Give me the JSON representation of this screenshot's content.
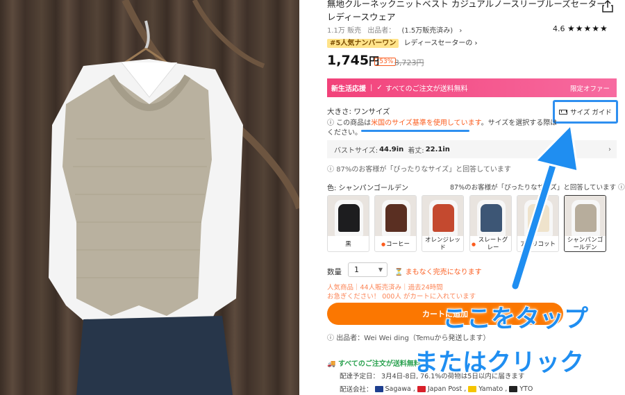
{
  "product": {
    "title": "無地クルーネックニットベスト カジュアルノースリーブルーズセーター レディースウェア",
    "sold": "1.1万 販売",
    "seller_label": "出品者：",
    "seller_sales": "(1.5万販売済み)",
    "rating": "4.6",
    "stars": "★★★★★",
    "rank_tag": "#5人気ナンバーワン",
    "rank_category": "レディースセーターの",
    "price": "1,745",
    "price_unit": "円",
    "discount": "-53%",
    "original_price": "3,723円"
  },
  "promo": {
    "label": "新生活応援",
    "text": "すべてのご注文が送料無料",
    "limited": "限定オファー"
  },
  "size": {
    "label": "大きさ: ワンサイズ",
    "guide_button": "サイズ ガイド",
    "note_prefix": "この商品は",
    "note_highlight": "米国のサイズ基準を使用しています",
    "note_suffix": "。サイズを選択する際はください。",
    "measure_bust_label": "バストサイズ:",
    "measure_bust": "44.9in",
    "measure_length_label": "着丈:",
    "measure_length": "22.1in",
    "fit_note": "87%のお客様が「ぴったりなサイズ」と回答しています"
  },
  "color": {
    "label": "色: シャンパンゴールデン",
    "fit_note": "87%のお客様が「ぴったりなサイズ」と回答しています",
    "swatches": [
      {
        "name": "黒",
        "color": "#1d1d1f",
        "hot": false
      },
      {
        "name": "コーヒー",
        "color": "#5a2f22",
        "hot": true
      },
      {
        "name": "オレンジレッド",
        "color": "#c4492f",
        "hot": false
      },
      {
        "name": "スレートグレー",
        "color": "#3d5675",
        "hot": true
      },
      {
        "name": "アプリコット",
        "color": "#efe3cc",
        "hot": false
      },
      {
        "name": "シャンパンゴールデン",
        "color": "#b7ad9c",
        "hot": false
      }
    ]
  },
  "quantity": {
    "label": "数量",
    "value": "1",
    "stock_warning": "まもなく完売になります"
  },
  "faded": {
    "line1": "人気商品｜44人販売済み｜過去24時間",
    "line2": "お急ぎください！ 000人 がカートに入れています"
  },
  "cart_button": "カートに追加",
  "seller_line": "出品者：Wei Wei ding（Temuから発送します）",
  "shipping": {
    "free": "すべてのご注文が送料無料",
    "delivery": "配達予定日： 3月4日-8日, 76.1%の荷物は5日以内に届きます",
    "carriers_label": "配送会社：",
    "carriers": [
      "Sagawa",
      "Japan Post",
      "Yamato",
      "YTO"
    ]
  },
  "annotation": {
    "line1": "ここをタップ",
    "line2": "またはクリック",
    "color": "#1f8ef1"
  }
}
